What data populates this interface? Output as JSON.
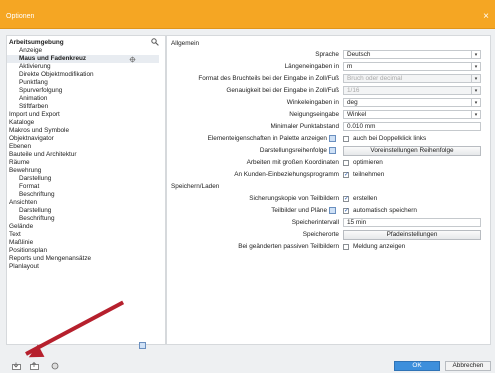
{
  "window": {
    "title": "Optionen",
    "close": "×"
  },
  "sidebar": {
    "items": [
      {
        "label": "Arbeitsumgebung",
        "level": 0,
        "bold": true
      },
      {
        "label": "Anzeige",
        "level": 1
      },
      {
        "label": "Maus und Fadenkreuz",
        "level": 1,
        "bold": true,
        "selected": true
      },
      {
        "label": "Aktivierung",
        "level": 1
      },
      {
        "label": "Direkte Objektmodifikation",
        "level": 1
      },
      {
        "label": "Punktfang",
        "level": 1
      },
      {
        "label": "Spurverfolgung",
        "level": 1
      },
      {
        "label": "Animation",
        "level": 1
      },
      {
        "label": "Stiftfarben",
        "level": 1
      },
      {
        "label": "Import und Export",
        "level": 0
      },
      {
        "label": "Kataloge",
        "level": 0
      },
      {
        "label": "Makros und Symbole",
        "level": 0
      },
      {
        "label": "Objektnavigator",
        "level": 0
      },
      {
        "label": "Ebenen",
        "level": 0
      },
      {
        "label": "Bauteile und Architektur",
        "level": 0
      },
      {
        "label": "Räume",
        "level": 0
      },
      {
        "label": "Bewehrung",
        "level": 0
      },
      {
        "label": "Darstellung",
        "level": 1
      },
      {
        "label": "Format",
        "level": 1
      },
      {
        "label": "Beschriftung",
        "level": 1
      },
      {
        "label": "Ansichten",
        "level": 0
      },
      {
        "label": "Darstellung",
        "level": 1
      },
      {
        "label": "Beschriftung",
        "level": 1
      },
      {
        "label": "Gelände",
        "level": 0
      },
      {
        "label": "Text",
        "level": 0
      },
      {
        "label": "Maßlinie",
        "level": 0
      },
      {
        "label": "Positionsplan",
        "level": 0
      },
      {
        "label": "Reports und Mengenansätze",
        "level": 0
      },
      {
        "label": "Planlayout",
        "level": 0
      }
    ]
  },
  "main": {
    "section_general": "Allgemein",
    "section_save": "Speichern/Laden",
    "rows": {
      "sprache": {
        "label": "Sprache",
        "value": "Deutsch"
      },
      "laengen": {
        "label": "Längeneingaben in",
        "value": "m"
      },
      "bruch": {
        "label": "Format des Bruchteils bei der Eingabe in Zoll/Fuß",
        "value": "Bruch oder decimal"
      },
      "genau": {
        "label": "Genauigkeit bei der Eingabe in Zoll/Fuß",
        "value": "1/16"
      },
      "winkel": {
        "label": "Winkeleingaben in",
        "value": "deg"
      },
      "neigung": {
        "label": "Neigungseingabe",
        "value": "Winkel"
      },
      "punkt": {
        "label": "Minimaler Punktabstand",
        "value": "0.010 mm"
      },
      "elem": {
        "label": "Elementeigenschaften in Palette anzeigen",
        "check": "auch bei Doppelklick links"
      },
      "darst": {
        "label": "Darstellungsreihenfolge",
        "button": "Voreinstellungen Reihenfolge"
      },
      "arbeit": {
        "label": "Arbeiten mit großen Koordinaten",
        "check": "optimieren"
      },
      "kunden": {
        "label": "An Kunden-Einbeziehungsprogramm",
        "check": "teilnehmen"
      },
      "sicher": {
        "label": "Sicherungskopie von Teilbildern",
        "check": "erstellen"
      },
      "teil": {
        "label": "Teilbilder und Pläne",
        "check": "automatisch speichern"
      },
      "interval": {
        "label": "Speicherintervall",
        "value": "15 min"
      },
      "orte": {
        "label": "Speicherorte",
        "button": "Pfadeinstellungen"
      },
      "passiv": {
        "label": "Bei geänderten passiven Teilbildern",
        "check": "Meldung anzeigen"
      }
    }
  },
  "footer": {
    "ok": "OK",
    "cancel": "Abbrechen"
  }
}
